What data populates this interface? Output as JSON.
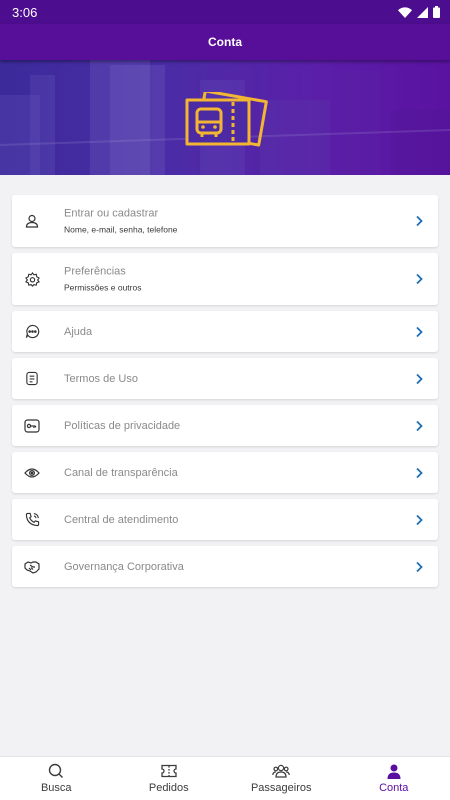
{
  "status_bar": {
    "time": "3:06"
  },
  "app_bar": {
    "title": "Conta"
  },
  "colors": {
    "primary": "#570e98",
    "accent": "#f2b632",
    "chevron": "#1f6fb5"
  },
  "menu": [
    {
      "title": "Entrar ou cadastrar",
      "subtitle": "Nome, e-mail, senha, telefone",
      "icon": "user-icon"
    },
    {
      "title": "Preferências",
      "subtitle": "Permissões e outros",
      "icon": "gear-icon"
    },
    {
      "title": "Ajuda",
      "icon": "chat-bubble-icon"
    },
    {
      "title": "Termos de Uso",
      "icon": "document-icon"
    },
    {
      "title": "Políticas de privacidade",
      "icon": "key-card-icon"
    },
    {
      "title": "Canal de transparência",
      "icon": "eye-icon"
    },
    {
      "title": "Central de atendimento",
      "icon": "phone-icon"
    },
    {
      "title": "Governança Corporativa",
      "icon": "handshake-icon"
    }
  ],
  "bottom_nav": [
    {
      "label": "Busca",
      "icon": "search-icon"
    },
    {
      "label": "Pedidos",
      "icon": "ticket-icon"
    },
    {
      "label": "Passageiros",
      "icon": "people-icon"
    },
    {
      "label": "Conta",
      "icon": "person-icon",
      "active": true
    }
  ]
}
